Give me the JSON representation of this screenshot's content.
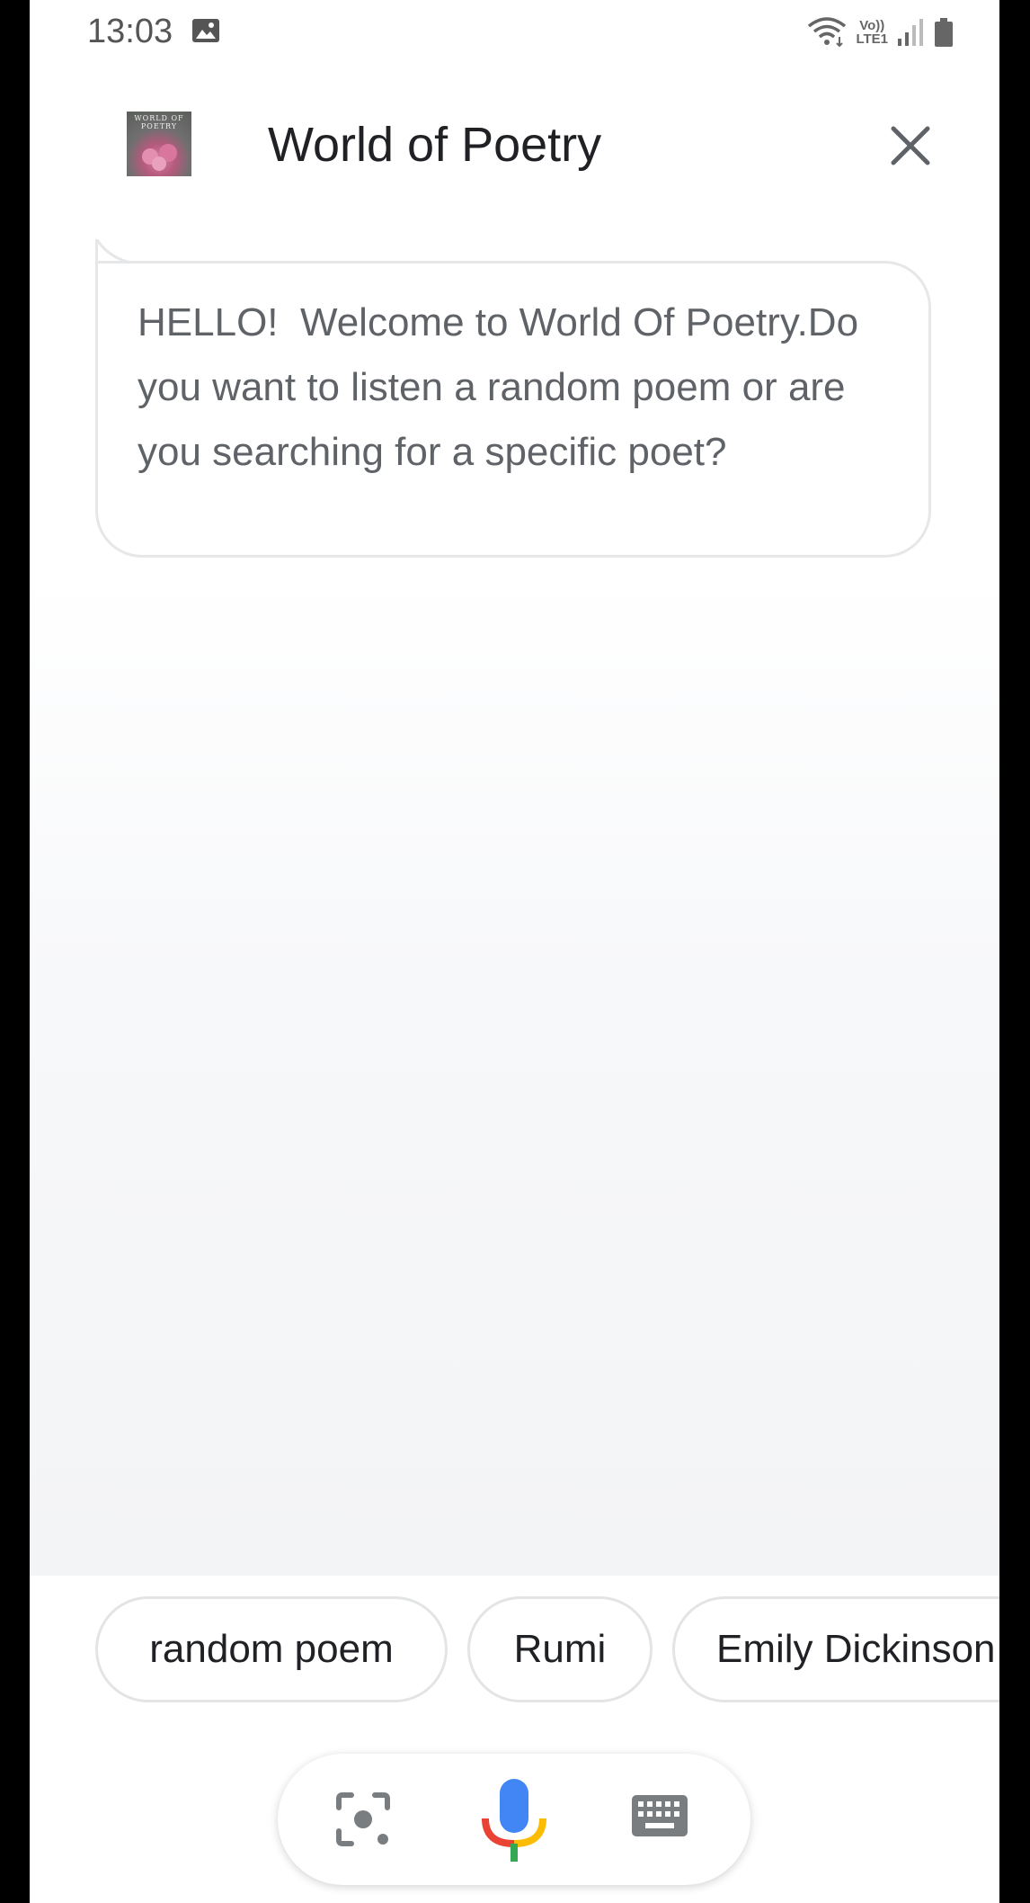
{
  "status_bar": {
    "time": "13:03",
    "lte_top": "Vo))",
    "lte_bottom": "LTE1"
  },
  "header": {
    "logo_text": "WORLD OF POETRY",
    "title": "World of Poetry",
    "close_icon": "close-icon"
  },
  "assistant_message": {
    "text": "HELLO!  Welcome to World Of Poetry.Do you want to listen a random poem or are you searching for a specific poet?"
  },
  "suggestion_chips": [
    {
      "label": "random poem"
    },
    {
      "label": "Rumi"
    },
    {
      "label": "Emily Dickinson"
    }
  ],
  "input_bar": {
    "lens_icon": "lens-icon",
    "mic_icon": "mic-icon",
    "keyboard_icon": "keyboard-icon"
  },
  "colors": {
    "mic_blue": "#4285F4",
    "mic_red": "#EA4335",
    "mic_yellow": "#FBBC05",
    "mic_green": "#34A853",
    "text_dark": "#202124",
    "text_gray": "#5f6368"
  }
}
